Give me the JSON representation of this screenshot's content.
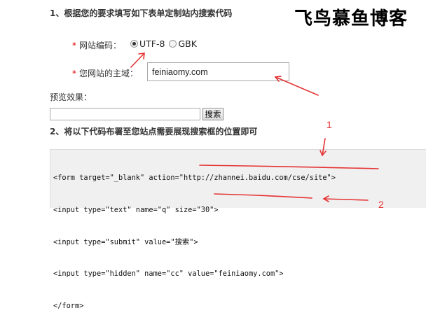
{
  "header": {
    "step1_title": "1、根据您的要求填写如下表单定制站内搜索代码",
    "brand": "飞鸟慕鱼博客"
  },
  "form": {
    "encoding_label": "网站编码：",
    "encoding_options": [
      {
        "label": "UTF-8",
        "checked": true
      },
      {
        "label": "GBK",
        "checked": false
      }
    ],
    "domain_label": "您网站的主域：",
    "domain_value": "feiniaomy.com",
    "required_mark": "*"
  },
  "preview": {
    "label": "预览效果：",
    "search_input_value": "",
    "search_button_label": "搜索"
  },
  "step2_title": "2、将以下代码布署至您站点需要展现搜索框的位置即可",
  "code": {
    "lines": [
      "<form target=\"_blank\" action=\"http://zhannei.baidu.com/cse/site\">",
      "<input type=\"text\" name=\"q\" size=\"30\">",
      "<input type=\"submit\" value=\"搜索\">",
      "<input type=\"hidden\" name=\"cc\" value=\"feiniaomy.com\">",
      "</form>"
    ]
  },
  "annotations": {
    "label_1": "1",
    "label_2": "2",
    "color": "#e53333"
  }
}
